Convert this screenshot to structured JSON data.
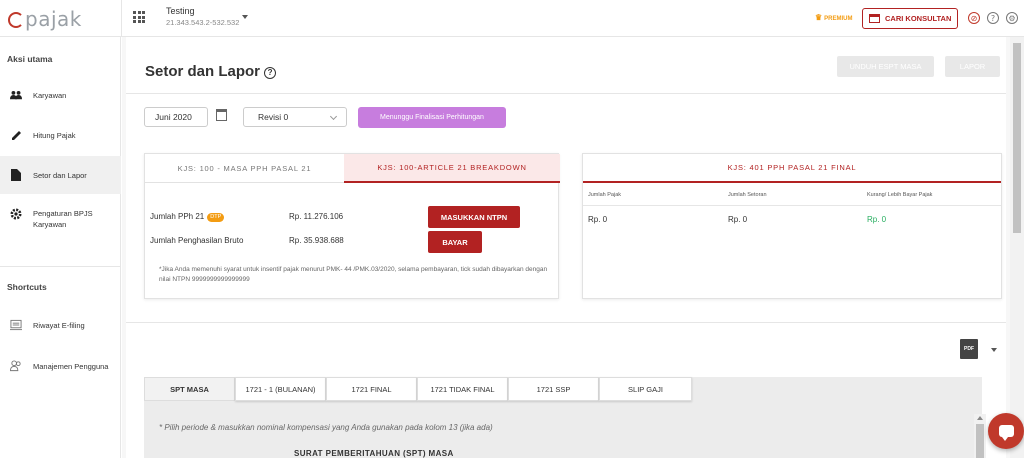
{
  "header": {
    "logo_text": "pajak",
    "company_name": "Testing",
    "company_npwp": "21.343.543.2-532.532",
    "premium_label": "PREMIUM",
    "cari_konsultan_label": "CARI KONSULTAN",
    "brand_color": "#b22222"
  },
  "sidebar": {
    "aksi_heading": "Aksi utama",
    "items": [
      {
        "label": "Karyawan",
        "icon": "people-icon"
      },
      {
        "label": "Hitung Pajak",
        "icon": "pencil-icon"
      },
      {
        "label": "Setor dan Lapor",
        "icon": "file-icon"
      },
      {
        "label": "Pengaturan BPJS Karyawan",
        "icon": "gear-icon"
      }
    ],
    "shortcuts_heading": "Shortcuts",
    "shortcuts": [
      {
        "label": "Riwayat E-filing",
        "icon": "history-icon"
      },
      {
        "label": "Manajemen Pengguna",
        "icon": "users-icon"
      }
    ]
  },
  "page": {
    "title": "Setor dan Lapor",
    "unduh_label": "UNDUH ESPT MASA",
    "lapor_label": "LAPOR",
    "period_value": "Juni 2020",
    "revisi_value": "Revisi 0",
    "status_label": "Menunggu Finalisasi Perhitungan"
  },
  "card1": {
    "tab_a": "KJS: 100 - MASA PPH PASAL 21",
    "tab_b": "KJS: 100-ARTICLE 21 BREAKDOWN",
    "row1_label": "Jumlah PPh 21",
    "dtp_badge": "DTP",
    "row1_value": "Rp. 11.276.106",
    "row1_button": "MASUKKAN NTPN",
    "row2_label": "Jumlah Penghasilan Bruto",
    "row2_value": "Rp. 35.938.688",
    "row2_button": "BAYAR",
    "note": "*Jika Anda memenuhi syarat untuk insentif pajak menurut PMK- 44 /PMK.03/2020, selama pembayaran, tick sudah dibayarkan dengan nilai NTPN 9999999999999999"
  },
  "card2": {
    "title": "KJS: 401 PPH PASAL 21 FINAL",
    "headers": [
      "Jumlah Pajak",
      "Jumlah Setoran",
      "Kurang/ Lebih Bayar Pajak"
    ],
    "values": [
      "Rp. 0",
      "Rp. 0",
      "Rp. 0"
    ],
    "positive_color": "#27ae60"
  },
  "bottom": {
    "pdf_label": "PDF",
    "tabs": [
      "SPT MASA",
      "1721 - 1 (BULANAN)",
      "1721 FINAL",
      "1721 TIDAK FINAL",
      "1721 SSP",
      "SLIP GAJI"
    ],
    "hint": "* Pilih periode & masukkan nominal kompensasi yang Anda gunakan pada kolom 13 (jika ada)",
    "doc_title": "SURAT PEMBERITAHUAN (SPT) MASA"
  }
}
